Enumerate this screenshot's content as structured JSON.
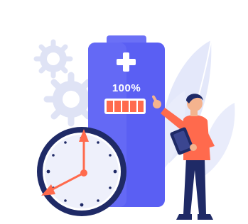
{
  "illustration": {
    "battery_text": "100%",
    "battery_level": 1.0,
    "colors": {
      "battery_body": "#5a5ff3",
      "battery_top": "#6b70f6",
      "charge_fill": "#ff6a4d",
      "gear": "#dfe3f5",
      "leaves": "#e4e8fa",
      "clock_rim": "#1f2a66",
      "clock_face": "#ffffff",
      "clock_hands": "#ff6a4d",
      "person_skin": "#f4b38e",
      "person_shirt": "#ff6a4d",
      "person_pants": "#1f2a66",
      "person_hair": "#1f2a66"
    }
  }
}
